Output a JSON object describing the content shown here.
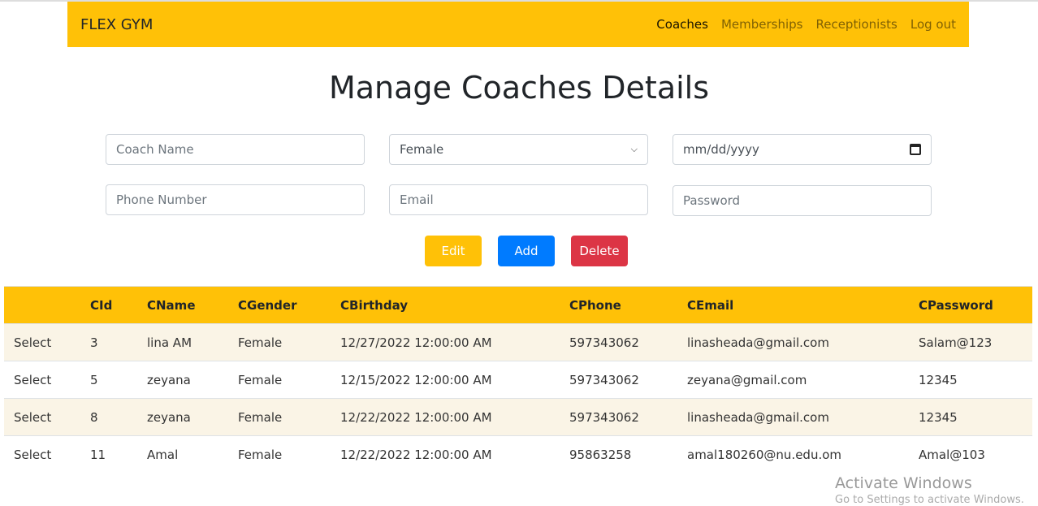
{
  "nav": {
    "brand": "FLEX GYM",
    "links": [
      "Coaches",
      "Memberships",
      "Receptionists",
      "Log out"
    ]
  },
  "title": "Manage Coaches Details",
  "form": {
    "coach_name_placeholder": "Coach Name",
    "gender": "Female",
    "date_placeholder": "mm/dd/yyyy",
    "phone_placeholder": "Phone Number",
    "email_placeholder": "Email",
    "password_placeholder": "Password"
  },
  "buttons": {
    "edit": "Edit",
    "add": "Add",
    "delete": "Delete"
  },
  "colors": {
    "accent": "#ffc107",
    "edit": "#ffc107",
    "add": "#007bff",
    "delete": "#dc3545"
  },
  "table": {
    "headers": [
      "",
      "CId",
      "CName",
      "CGender",
      "CBirthday",
      "CPhone",
      "CEmail",
      "CPassword"
    ],
    "rows": [
      [
        "Select",
        "3",
        "lina AM",
        "Female",
        "12/27/2022 12:00:00 AM",
        "597343062",
        "linasheada@gmail.com",
        "Salam@123"
      ],
      [
        "Select",
        "5",
        "zeyana",
        "Female",
        "12/15/2022 12:00:00 AM",
        "597343062",
        "zeyana@gmail.com",
        "12345"
      ],
      [
        "Select",
        "8",
        "zeyana",
        "Female",
        "12/22/2022 12:00:00 AM",
        "597343062",
        "linasheada@gmail.com",
        "12345"
      ],
      [
        "Select",
        "11",
        "Amal",
        "Female",
        "12/22/2022 12:00:00 AM",
        "95863258",
        "amal180260@nu.edu.om",
        "Amal@103"
      ]
    ]
  },
  "watermark": {
    "title": "Activate Windows",
    "subtitle": "Go to Settings to activate Windows."
  }
}
